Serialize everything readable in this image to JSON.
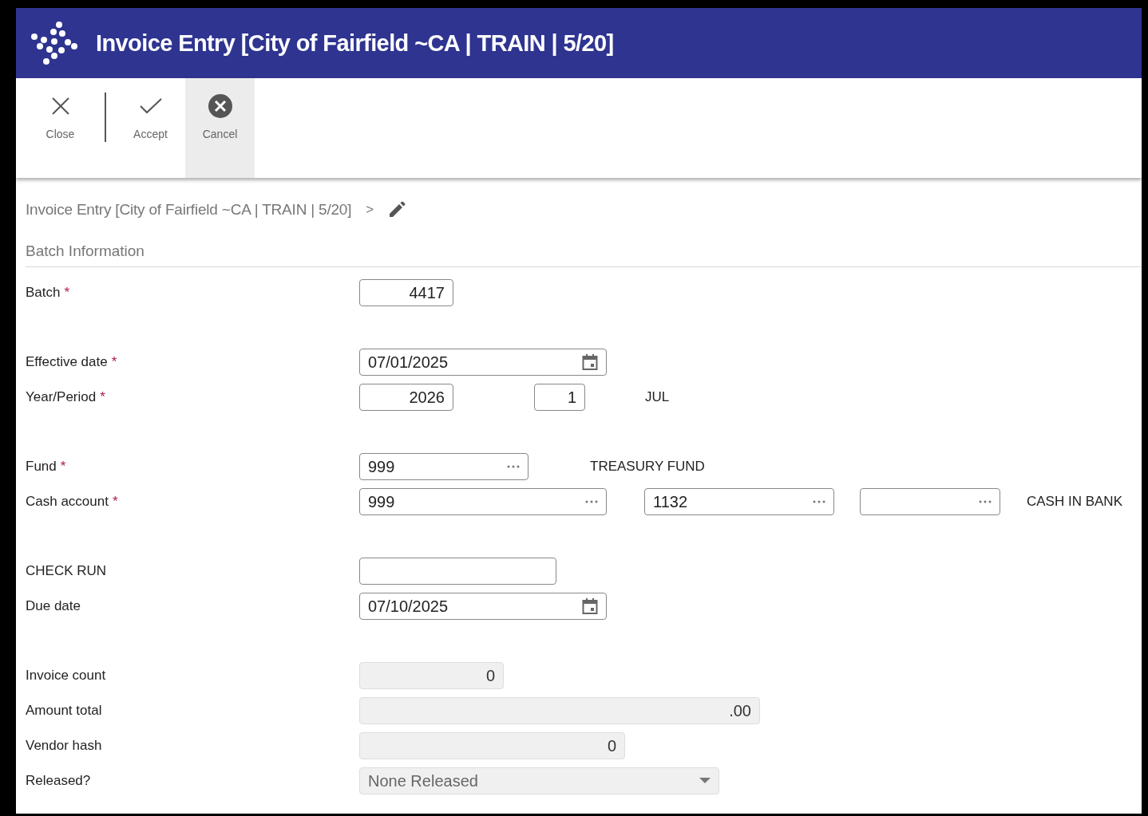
{
  "window": {
    "title": "Invoice Entry [City of Fairfield ~CA | TRAIN | 5/20]"
  },
  "toolbar": [
    {
      "label": "Close",
      "kind": "close",
      "highlighted": false,
      "separator_after": true
    },
    {
      "label": "Accept",
      "kind": "check",
      "highlighted": false,
      "separator_after": false
    },
    {
      "label": "Cancel",
      "kind": "cancel",
      "highlighted": true,
      "separator_after": false
    }
  ],
  "breadcrumb": {
    "path": "Invoice Entry [City of Fairfield ~CA | TRAIN | 5/20]",
    "separator": ">"
  },
  "section": {
    "title": "Batch Information"
  },
  "groups": [
    {
      "rows": [
        {
          "label": "Batch",
          "required_mark": "*",
          "fields": [
            {
              "kind": "number",
              "value": "4417"
            }
          ]
        }
      ]
    },
    {
      "rows": [
        {
          "label": "Effective date",
          "required_mark": "*",
          "fields": [
            {
              "kind": "date",
              "value": "07/01/2025"
            }
          ]
        },
        {
          "label": "Year/Period",
          "required_mark": "*",
          "fields": [
            {
              "kind": "number",
              "value": "2026"
            },
            {
              "kind": "number",
              "value": "1"
            },
            {
              "kind": "description",
              "value": "JUL"
            }
          ]
        }
      ]
    },
    {
      "rows": [
        {
          "label": "Fund",
          "required_mark": "*",
          "fields": [
            {
              "kind": "lookup",
              "value": "999"
            },
            {
              "kind": "description",
              "value": "TREASURY FUND"
            }
          ]
        },
        {
          "label": "Cash account",
          "required_mark": "*",
          "fields": [
            {
              "kind": "lookup",
              "value": "999"
            },
            {
              "kind": "lookup",
              "value": "1132"
            },
            {
              "kind": "lookup"
            },
            {
              "kind": "description",
              "value": "CASH IN BANK"
            }
          ]
        }
      ]
    },
    {
      "rows": [
        {
          "label": "CHECK RUN",
          "fields": [
            {
              "kind": "text"
            }
          ]
        },
        {
          "label": "Due date",
          "fields": [
            {
              "kind": "date",
              "value": "07/10/2025"
            }
          ]
        }
      ]
    },
    {
      "rows": [
        {
          "label": "Invoice count",
          "fields": [
            {
              "kind": "readonly",
              "value": "0"
            }
          ]
        },
        {
          "label": "Amount total",
          "fields": [
            {
              "kind": "readonly",
              "value": ".00"
            }
          ]
        },
        {
          "label": "Vendor hash",
          "fields": [
            {
              "kind": "readonly",
              "value": "0"
            }
          ]
        },
        {
          "label": "Released?",
          "fields": [
            {
              "kind": "select",
              "value": "None Released"
            }
          ]
        }
      ]
    }
  ]
}
